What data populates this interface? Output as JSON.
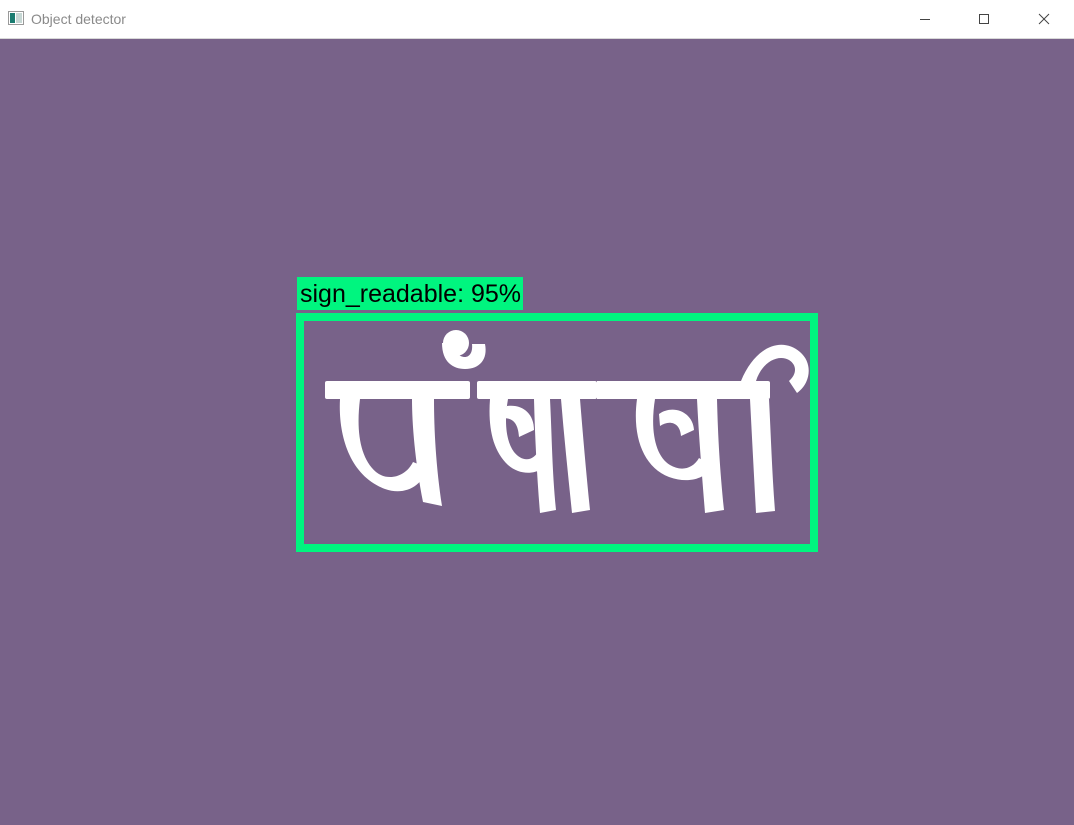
{
  "window": {
    "title": "Object detector",
    "controls": {
      "minimize_icon": "minimize-icon",
      "maximize_icon": "maximize-icon",
      "close_icon": "close-icon"
    }
  },
  "detection": {
    "label": "sign_readable: 95%",
    "class_name": "sign_readable",
    "confidence_percent": 95,
    "box_color": "#00f57f"
  },
  "scene": {
    "background_color": "#786289",
    "sign_text": "ਪੰਜਾਬੀ",
    "sign_text_color": "#ffffff"
  }
}
